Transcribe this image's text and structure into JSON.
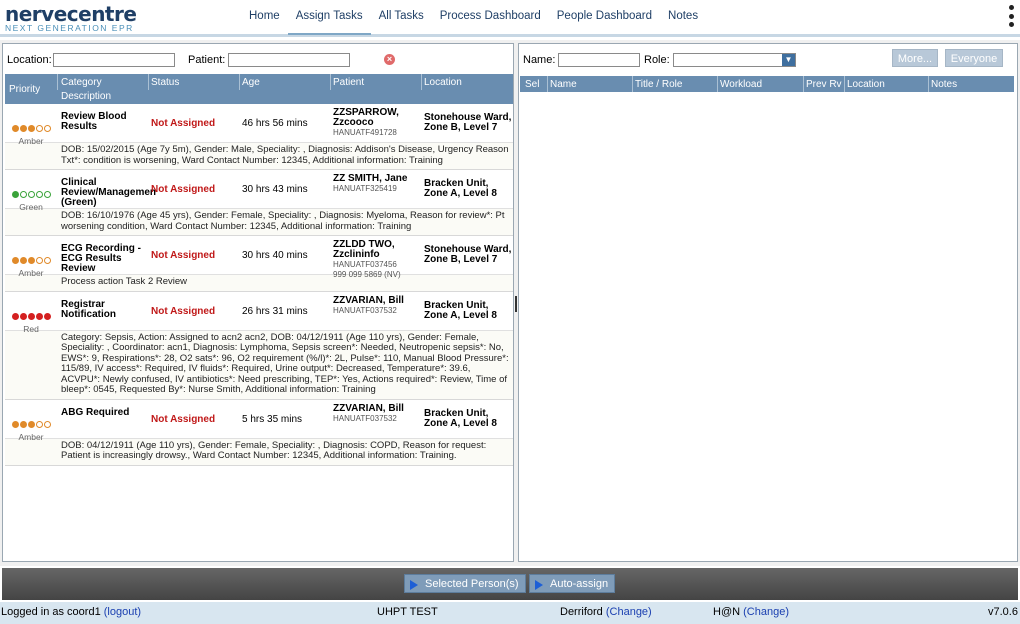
{
  "logo": {
    "name": "nervecentre",
    "tagline": "NEXT GENERATION EPR"
  },
  "nav": [
    "Home",
    "Assign Tasks",
    "All Tasks",
    "Process Dashboard",
    "People Dashboard",
    "Notes"
  ],
  "nav_active": "Assign Tasks",
  "left_filter": {
    "location_label": "Location:",
    "location_value": "",
    "patient_label": "Patient:",
    "patient_value": ""
  },
  "task_columns": {
    "priority": "Priority",
    "category": "Category",
    "status": "Status",
    "age": "Age",
    "patient": "Patient",
    "location": "Location",
    "description": "Description"
  },
  "tasks": [
    {
      "priority": "Amber",
      "category": "Review Blood Results",
      "status": "Not Assigned",
      "age": "46 hrs 56 mins",
      "patient_name": "ZZSPARROW, Zzcooco",
      "patient_id": "HANUATF491728",
      "patient_nhs": "",
      "location": "Stonehouse Ward, Zone B, Level 7",
      "description": "DOB: 15/02/2015 (Age 7y 5m), Gender: Male, Speciality: , Diagnosis: Addison's Disease, Urgency Reason Txt*: condition is worsening, Ward Contact Number: 12345, Additional information: Training"
    },
    {
      "priority": "Green",
      "category": "Clinical Review/Managemen (Green)",
      "status": "Not Assigned",
      "age": "30 hrs 43 mins",
      "patient_name": "ZZ SMITH, Jane",
      "patient_id": "HANUATF325419",
      "patient_nhs": "",
      "location": "Bracken Unit, Zone A, Level 8",
      "description": "DOB: 16/10/1976 (Age 45 yrs), Gender: Female, Speciality: , Diagnosis: Myeloma, Reason for review*: Pt worsening condition, Ward Contact Number: 12345, Additional information: Training"
    },
    {
      "priority": "Amber",
      "category": "ECG Recording - ECG Results Review",
      "status": "Not Assigned",
      "age": "30 hrs 40 mins",
      "patient_name": "ZZLDD TWO, Zzclininfo",
      "patient_id": "HANUATF037456",
      "patient_nhs": "999 099 5869 (NV)",
      "location": "Stonehouse Ward, Zone B, Level 7",
      "description": "Process action Task 2 Review"
    },
    {
      "priority": "Red",
      "category": "Registrar Notification",
      "status": "Not Assigned",
      "age": "26 hrs 31 mins",
      "patient_name": "ZZVARIAN, Bill",
      "patient_id": "HANUATF037532",
      "patient_nhs": "",
      "location": "Bracken Unit, Zone A, Level 8",
      "description": "Category: Sepsis, Action: Assigned to acn2 acn2, DOB: 04/12/1911 (Age 110 yrs), Gender: Female, Speciality: , Coordinator: acn1, Diagnosis: Lymphoma, Sepsis screen*: Needed, Neutropenic sepsis*: No, EWS*: 9, Respirations*: 28, O2 sats*: 96, O2 requirement (%/l)*: 2L, Pulse*: 110, Manual Blood Pressure*: 115/89, IV access*: Required, IV fluids*: Required, Urine output*: Decreased, Temperature*: 39.6, ACVPU*: Newly confused, IV antibiotics*: Need prescribing, TEP*: Yes, Actions required*: Review, Time of bleep*: 0545, Requested By*: Nurse Smith, Additional information: Training"
    },
    {
      "priority": "Amber",
      "category": "ABG Required",
      "status": "Not Assigned",
      "age": "5 hrs 35 mins",
      "patient_name": "ZZVARIAN, Bill",
      "patient_id": "HANUATF037532",
      "patient_nhs": "",
      "location": "Bracken Unit, Zone A, Level 8",
      "description": "DOB: 04/12/1911 (Age 110 yrs), Gender: Female, Speciality: , Diagnosis: COPD, Reason for request: Patient is increasingly drowsy., Ward Contact Number: 12345, Additional information: Training."
    }
  ],
  "right_filter": {
    "name_label": "Name:",
    "name_value": "",
    "role_label": "Role:",
    "role_value": "",
    "more_label": "More...",
    "everyone_label": "Everyone"
  },
  "staff_columns": [
    "Sel",
    "Name",
    "Title / Role",
    "Workload",
    "Prev Rv",
    "Location",
    "Notes"
  ],
  "bottom_buttons": {
    "selected": "Selected Person(s)",
    "auto": "Auto-assign"
  },
  "status_bar": {
    "logged_in": "Logged in as coord1",
    "logout": "(logout)",
    "site": "UHPT TEST",
    "hospital": "Derriford",
    "hospital_change": "(Change)",
    "hn": "H@N",
    "hn_change": "(Change)",
    "version": "v7.0.6"
  },
  "colors": {
    "header_bar": "#698db0",
    "amber": "#e08a2a",
    "green": "#3aa33a",
    "red": "#d42020",
    "status_text": "#c01818"
  }
}
